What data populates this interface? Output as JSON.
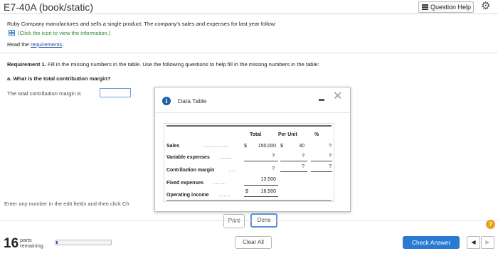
{
  "header": {
    "title": "E7-40A (book/static)",
    "help_label": "Question Help"
  },
  "problem": {
    "intro": "Ruby Company manufactures and sells a single product. The company's sales and expenses for last year follow:",
    "info_link": "(Click the icon to view the information.)",
    "read_prefix": "Read the ",
    "requirements_link": "requirements",
    "read_suffix": "."
  },
  "requirement": {
    "label": "Requirement 1.",
    "text": " Fill in the missing numbers in the table. Use the following questions to help fill in the missing numbers in the table:",
    "question": "a. What is the total contribution margin?",
    "answer_prefix": "The total contribution margin is",
    "answer_value": "",
    "answer_suffix": "."
  },
  "footer_hint": "Enter any number in the edit fields and then click Ch",
  "modal": {
    "title": "Data Table",
    "headers": {
      "total": "Total",
      "per_unit": "Per Unit",
      "percent": "%"
    },
    "rows": [
      {
        "label": "Sales",
        "dots": "...............",
        "dollar_total": "$",
        "total": "150,000",
        "dollar_unit": "$",
        "per_unit": "30",
        "percent": "?"
      },
      {
        "label": "Variable expenses",
        "dots": ".......",
        "total": "?",
        "per_unit": "?",
        "percent": "?"
      },
      {
        "label": "Contribution margin",
        "dots": "....",
        "total": "?",
        "per_unit": "?",
        "percent": "?"
      },
      {
        "label": "Fixed expenses",
        "dots": "........",
        "total": "13,500"
      },
      {
        "label": "Operating income",
        "dots": ".......",
        "dollar_total": "$",
        "total": "16,500"
      }
    ],
    "print_label": "Print",
    "done_label": "Done"
  },
  "status": {
    "parts_count": "16",
    "parts_label_1": "parts",
    "parts_label_2": "remaining",
    "progress": 0.02,
    "clear_label": "Clear All",
    "check_label": "Check Answer",
    "help_glyph": "?"
  },
  "colors": {
    "accent": "#2a7ad3",
    "link": "#1a4fa0",
    "green": "#2c8a2c",
    "help": "#e8a020"
  },
  "icons": [
    "menu-lines-icon",
    "gear-icon",
    "table-icon",
    "info-icon",
    "minimize-icon",
    "close-icon",
    "help-icon",
    "prev-arrow-icon",
    "next-arrow-icon"
  ]
}
